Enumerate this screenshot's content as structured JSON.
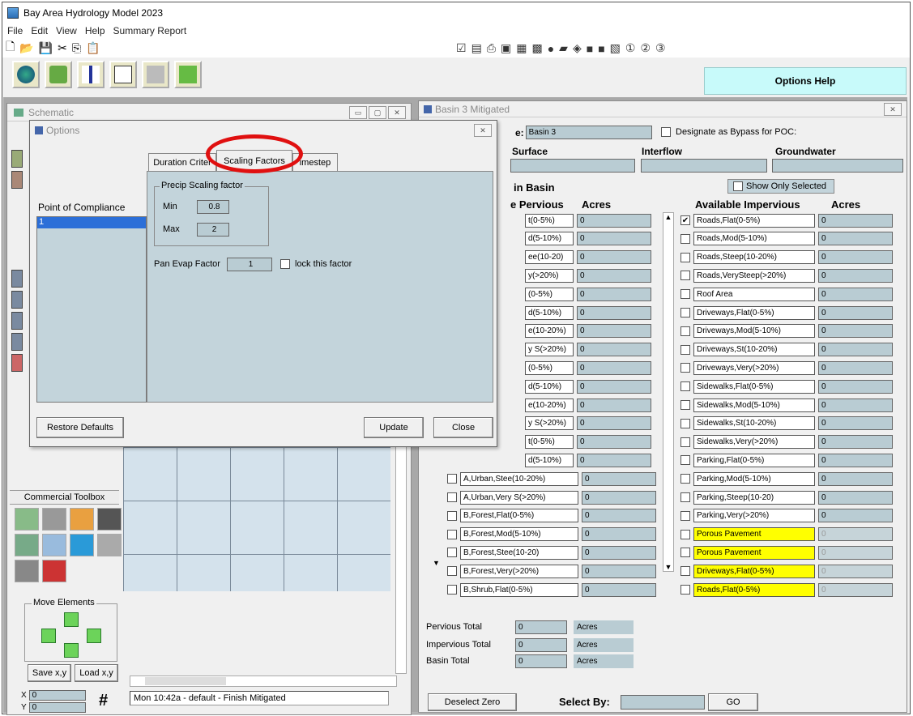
{
  "app": {
    "title": "Bay Area Hydrology Model 2023",
    "menu": [
      "File",
      "Edit",
      "View",
      "Help",
      "Summary Report"
    ],
    "options_help": "Options Help"
  },
  "schematic": {
    "title": "Schematic",
    "status": "Mon 10:42a - default - Finish Mitigated",
    "toolbox_title": "Commercial Toolbox",
    "move_elements": "Move Elements",
    "save_xy": "Save x,y",
    "load_xy": "Load x,y",
    "x_label": "X",
    "y_label": "Y",
    "x_val": "0",
    "y_val": "0"
  },
  "options": {
    "title": "Options",
    "poc_label": "Point of Compliance",
    "poc_item": "1",
    "tabs": [
      "Duration Criter",
      "Scaling Factors",
      "imestep"
    ],
    "precip_group": "Precip Scaling factor",
    "min_label": "Min",
    "min_val": "0.8",
    "max_label": "Max",
    "max_val": "2",
    "pan_label": "Pan Evap Factor",
    "pan_val": "1",
    "lock_label": "lock  this factor",
    "restore": "Restore Defaults",
    "update": "Update",
    "close": "Close"
  },
  "basin": {
    "title": "Basin 3 Mitigated",
    "name_label": "e:",
    "name_val": "Basin 3",
    "bypass_label": "Designate as Bypass for POC:",
    "surface": "Surface",
    "interflow": "Interflow",
    "groundwater": "Groundwater",
    "in_basin": "in Basin",
    "show_only": "Show Only Selected",
    "pervious_hdr": "e Pervious",
    "acres_hdr": "Acres",
    "impervious_hdr": "Available Impervious",
    "pervious": [
      "t(0-5%)",
      "d(5-10%)",
      "ee(10-20)",
      "y(>20%)",
      "(0-5%)",
      "d(5-10%)",
      "e(10-20%)",
      "y S(>20%)",
      "(0-5%)",
      "d(5-10%)",
      "e(10-20%)",
      "y S(>20%)",
      "t(0-5%)",
      "d(5-10%)",
      "A,Urban,Stee(10-20%)",
      "A,Urban,Very S(>20%)",
      "B,Forest,Flat(0-5%)",
      "B,Forest,Mod(5-10%)",
      "B,Forest,Stee(10-20)",
      "B,Forest,Very(>20%)",
      "B,Shrub,Flat(0-5%)"
    ],
    "impervious": [
      "Roads,Flat(0-5%)",
      "Roads,Mod(5-10%)",
      "Roads,Steep(10-20%)",
      "Roads,VerySteep(>20%)",
      "Roof Area",
      "Driveways,Flat(0-5%)",
      "Driveways,Mod(5-10%)",
      "Driveways,St(10-20%)",
      "Driveways,Very(>20%)",
      "Sidewalks,Flat(0-5%)",
      "Sidewalks,Mod(5-10%)",
      "Sidewalks,St(10-20%)",
      "Sidewalks,Very(>20%)",
      "Parking,Flat(0-5%)",
      "Parking,Mod(5-10%)",
      "Parking,Steep(10-20)",
      "Parking,Very(>20%)",
      "Porous Pavement",
      "Porous Pavement",
      "Driveways,Flat(0-5%)",
      "Roads,Flat(0-5%)"
    ],
    "zero": "0",
    "pervious_total": "Pervious Total",
    "impervious_total": "Impervious Total",
    "basin_total": "Basin Total",
    "acres": "Acres",
    "deselect": "Deselect Zero",
    "select_by": "Select By:",
    "go": "GO"
  },
  "colors": {
    "highlight": "#ffff00",
    "field": "#b9ccd3",
    "panel": "#c3d4db",
    "annotation": "#e01010"
  }
}
